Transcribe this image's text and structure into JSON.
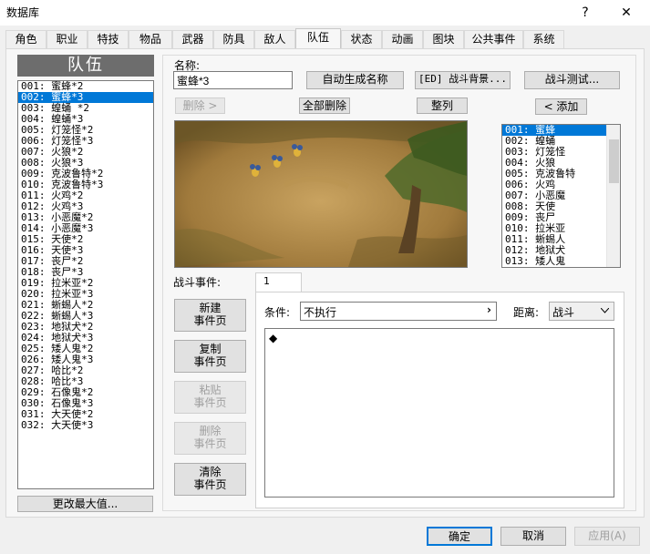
{
  "window": {
    "title": "数据库",
    "help_btn": "?",
    "close_btn": "✕"
  },
  "tabs": [
    "角色",
    "职业",
    "特技",
    "物品",
    "武器",
    "防具",
    "敌人",
    "队伍",
    "状态",
    "动画",
    "图块",
    "公共事件",
    "系统"
  ],
  "active_tab": "队伍",
  "troop_panel": {
    "header": "队伍",
    "items": [
      "001: 蜜蜂*2",
      "002: 蜜蜂*3",
      "003: 蝗蛹 *2",
      "004: 蝗蛹*3",
      "005: 灯笼怪*2",
      "006: 灯笼怪*3",
      "007: 火狼*2",
      "008: 火狼*3",
      "009: 克波鲁特*2",
      "010: 克波鲁特*3",
      "011: 火鸡*2",
      "012: 火鸡*3",
      "013: 小恶魔*2",
      "014: 小恶魔*3",
      "015: 天使*2",
      "016: 天使*3",
      "017: 丧尸*2",
      "018: 丧尸*3",
      "019: 拉米亚*2",
      "020: 拉米亚*3",
      "021: 蜥蜴人*2",
      "022: 蜥蜴人*3",
      "023: 地狱犬*2",
      "024: 地狱犬*3",
      "025: 矮人鬼*2",
      "026: 矮人鬼*3",
      "027: 哈比*2",
      "028: 哈比*3",
      "029: 石像鬼*2",
      "030: 石像鬼*3",
      "031: 大天使*2",
      "032: 大天使*3"
    ],
    "selected_index": 1,
    "change_max_button": "更改最大值..."
  },
  "editor": {
    "name_label": "名称:",
    "name_value": "蜜蜂*3",
    "auto_name_button": "自动生成名称",
    "battleback_button": "[ED] 战斗背景...",
    "battle_test_button": "战斗测试...",
    "remove_button": "删除 >",
    "clear_all_button": "全部删除",
    "align_button": "整列",
    "add_button": "< 添加"
  },
  "enemy_list": {
    "items": [
      "001: 蜜蜂",
      "002: 蝗蛹",
      "003: 灯笼怪",
      "004: 火狼",
      "005: 克波鲁特",
      "006: 火鸡",
      "007: 小恶魔",
      "008: 天使",
      "009: 丧尸",
      "010: 拉米亚",
      "011: 蜥蜴人",
      "012: 地狱犬",
      "013: 矮人鬼"
    ],
    "selected_index": 0
  },
  "battle_events": {
    "label": "战斗事件:",
    "page_tab": "1",
    "new_page": [
      "新建",
      "事件页"
    ],
    "copy_page": [
      "复制",
      "事件页"
    ],
    "paste_page": [
      "粘贴",
      "事件页"
    ],
    "delete_page": [
      "删除",
      "事件页"
    ],
    "clear_page": [
      "清除",
      "事件页"
    ],
    "condition_label": "条件:",
    "condition_value": "不执行",
    "condition_arrow": "›",
    "span_label": "距离:",
    "span_value": "战斗",
    "command_marker": "◆"
  },
  "footer": {
    "ok": "确定",
    "cancel": "取消",
    "apply": "应用(A)"
  },
  "colors": {
    "selection": "#0078d7",
    "header_bg": "#6d6d6d"
  }
}
